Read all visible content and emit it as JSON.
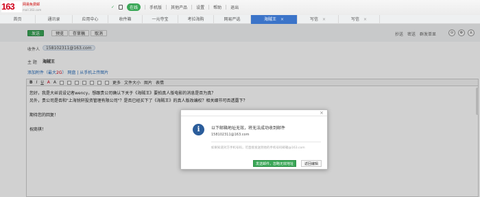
{
  "logo": {
    "num": "163",
    "cn": "网易免费邮",
    "sub": "mail.163.com"
  },
  "topnav": {
    "status": "在线",
    "items": [
      "手机版",
      "其他产品",
      "设置",
      "帮助",
      "退出"
    ]
  },
  "tabs": [
    {
      "label": "首页"
    },
    {
      "label": "通讯录"
    },
    {
      "label": "应用中心"
    },
    {
      "label": "收件箱"
    },
    {
      "label": "一元夺宝"
    },
    {
      "label": "考拉海购"
    },
    {
      "label": "网易严选"
    },
    {
      "label": "海賊王",
      "active": true,
      "close": "×"
    },
    {
      "label": "写信",
      "close": "×"
    },
    {
      "label": "写信",
      "close": "×"
    }
  ],
  "toolbar": {
    "send": "发送",
    "preview": "预览",
    "save_draft": "存草稿",
    "cancel": "取消",
    "right_links": [
      "抄送",
      "密送",
      "群发单显"
    ]
  },
  "recipient": {
    "label": "收件人",
    "chip": "158102311@163.com"
  },
  "subject": {
    "label": "主 题",
    "value": "海賊王"
  },
  "attach": {
    "text": "添加附件（最大",
    "limit": "2G",
    "mid": "）",
    "more": "网盘 | 从手机上传图片"
  },
  "editorbar": {
    "items": [
      "B",
      "I",
      "U",
      "A",
      "A"
    ],
    "right": [
      "更多",
      "文件大小",
      "图片",
      "表情"
    ]
  },
  "body": {
    "l1": "您好，我是大丝说设记者wency，想跟贵公司确认下关于《海贼王》要拍真人版电影的消息是否为真？",
    "l2": "另外，贵公司是否和\"上海锐轩投资管理有限公司\"？是否已经买下了《海贼王》的真人版改编权？相关细节可否透露下？",
    "l3": "期待您的回复！",
    "l4": "祝商祺！"
  },
  "modal": {
    "close": "×",
    "title": "以下邮箱地址无效，将无法成功收到邮件",
    "address": "158102311@163.com",
    "hint": "如果知道对方手机号码，可直接发送到他的手机号码邮箱@163.com",
    "btn_send": "发送邮件，忽略无效地址",
    "btn_back": "返回编辑"
  },
  "colors": {
    "accent": "#3b74c9",
    "green": "#3aa757",
    "brand": "#d0021b"
  }
}
